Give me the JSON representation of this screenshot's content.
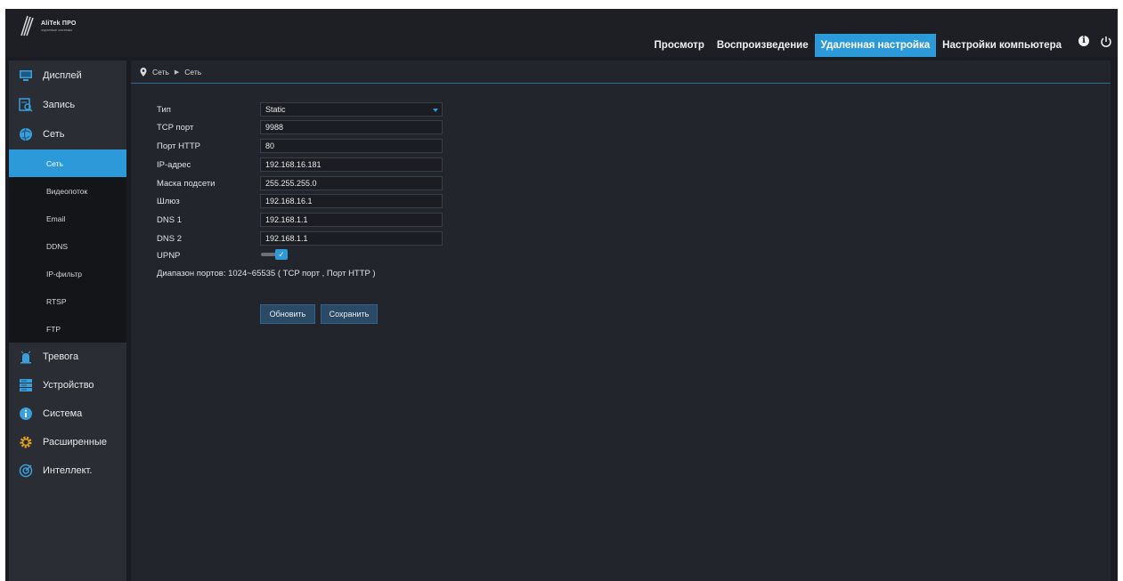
{
  "brand": {
    "name": "AliTek ПРО",
    "tagline": "охранные системы"
  },
  "nav": {
    "items": [
      {
        "label": "Просмотр"
      },
      {
        "label": "Воспроизведение"
      },
      {
        "label": "Удаленная настройка"
      },
      {
        "label": "Настройки компьютера"
      }
    ],
    "active_index": 2
  },
  "sidebar": {
    "top_items": [
      {
        "label": "Дисплей",
        "icon": "monitor-icon"
      },
      {
        "label": "Запись",
        "icon": "record-icon"
      },
      {
        "label": "Сеть",
        "icon": "network-icon"
      }
    ],
    "sub_items": [
      {
        "label": "Сеть"
      },
      {
        "label": "Видеопоток"
      },
      {
        "label": "Email"
      },
      {
        "label": "DDNS"
      },
      {
        "label": "IP-фильтр"
      },
      {
        "label": "RTSP"
      },
      {
        "label": "FTP"
      }
    ],
    "active_sub_index": 0,
    "bottom_items": [
      {
        "label": "Тревога",
        "icon": "alarm-icon"
      },
      {
        "label": "Устройство",
        "icon": "device-icon"
      },
      {
        "label": "Система",
        "icon": "info-icon"
      },
      {
        "label": "Расширенные",
        "icon": "gear-icon"
      },
      {
        "label": "Интеллект.",
        "icon": "intellect-icon"
      }
    ]
  },
  "breadcrumb": {
    "section": "Сеть",
    "page": "Сеть"
  },
  "form": {
    "type": {
      "label": "Тип",
      "value": "Static"
    },
    "tcp_port": {
      "label": "TCP порт",
      "value": "9988"
    },
    "http_port": {
      "label": "Порт HTTP",
      "value": "80"
    },
    "ip": {
      "label": "IP-адрес",
      "value": "192.168.16.181"
    },
    "mask": {
      "label": "Маска подсети",
      "value": "255.255.255.0"
    },
    "gateway": {
      "label": "Шлюз",
      "value": "192.168.16.1"
    },
    "dns1": {
      "label": "DNS 1",
      "value": "192.168.1.1"
    },
    "dns2": {
      "label": "DNS 2",
      "value": "192.168.1.1"
    },
    "upnp": {
      "label": "UPNP",
      "enabled": true
    },
    "port_range_note": "Диапазон портов: 1024~65535 ( TCP порт , Порт HTTP )"
  },
  "buttons": {
    "refresh": "Обновить",
    "save": "Сохранить"
  },
  "colors": {
    "accent": "#2c9ad8",
    "background": "#22252c",
    "sidebar": "#2a2d33"
  }
}
